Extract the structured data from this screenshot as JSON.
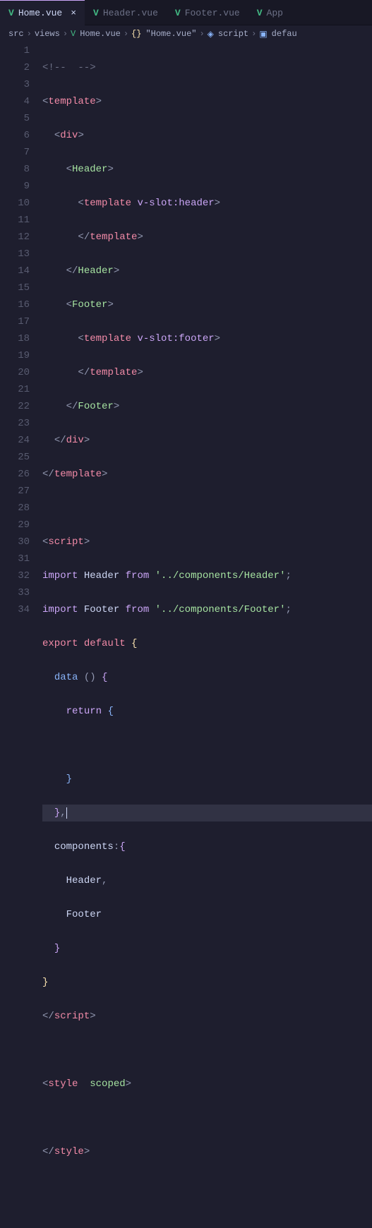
{
  "tabs": [
    {
      "label": "Home.vue",
      "active": true,
      "closable": true
    },
    {
      "label": "Header.vue",
      "active": false,
      "closable": false
    },
    {
      "label": "Footer.vue",
      "active": false,
      "closable": false
    },
    {
      "label": "App",
      "active": false,
      "closable": false
    }
  ],
  "breadcrumbs": {
    "src": "src",
    "views": "views",
    "file": "Home.vue",
    "region": "\"Home.vue\"",
    "script": "script",
    "default": "defau"
  },
  "code": {
    "l1": "<!--  -->",
    "l2a": "<",
    "l2b": "template",
    "l2c": ">",
    "l3a": "<",
    "l3b": "div",
    "l3c": ">",
    "l4a": "<",
    "l4b": "Header",
    "l4c": ">",
    "l5a": "<",
    "l5b": "template",
    "l5c": " ",
    "l5d": "v-slot:header",
    "l5e": ">",
    "l6a": "</",
    "l6b": "template",
    "l6c": ">",
    "l7a": "</",
    "l7b": "Header",
    "l7c": ">",
    "l8a": "<",
    "l8b": "Footer",
    "l8c": ">",
    "l9a": "<",
    "l9b": "template",
    "l9c": " ",
    "l9d": "v-slot:footer",
    "l9e": ">",
    "l10a": "</",
    "l10b": "template",
    "l10c": ">",
    "l11a": "</",
    "l11b": "Footer",
    "l11c": ">",
    "l12a": "</",
    "l12b": "div",
    "l12c": ">",
    "l13a": "</",
    "l13b": "template",
    "l13c": ">",
    "l15a": "<",
    "l15b": "script",
    "l15c": ">",
    "l16a": "import",
    "l16b": " Header ",
    "l16c": "from",
    "l16d": " ",
    "l16e": "'../components/Header'",
    "l16f": ";",
    "l17a": "import",
    "l17b": " Footer ",
    "l17c": "from",
    "l17d": " ",
    "l17e": "'../components/Footer'",
    "l17f": ";",
    "l18a": "export",
    "l18b": " ",
    "l18c": "default",
    "l18d": " ",
    "l18e": "{",
    "l19a": "data",
    "l19b": " () ",
    "l19c": "{",
    "l20a": "return",
    "l20b": " ",
    "l20c": "{",
    "l22a": "}",
    "l23a": "}",
    "l23b": ",",
    "l24a": "components",
    "l24b": ":",
    "l24c": "{",
    "l25a": "Header",
    "l25b": ",",
    "l26a": "Footer",
    "l27a": "}",
    "l28a": "}",
    "l29a": "</",
    "l29b": "script",
    "l29c": ">",
    "l31a": "<",
    "l31b": "style",
    "l31c": "  ",
    "l31d": "scoped",
    "l31e": ">",
    "l33a": "</",
    "l33b": "style",
    "l33c": ">"
  },
  "lineCount": 34
}
